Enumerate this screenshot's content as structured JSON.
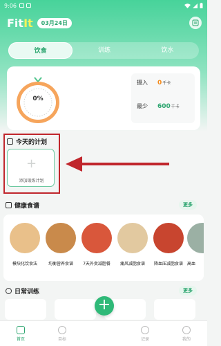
{
  "status_bar": {
    "time": "9:06"
  },
  "header": {
    "logo_main": "Fit",
    "logo_accent": "It",
    "date": "03月24日"
  },
  "tabs": [
    {
      "label": "饮食",
      "active": true
    },
    {
      "label": "训练",
      "active": false
    },
    {
      "label": "饮水",
      "active": false
    }
  ],
  "summary": {
    "percent": "0%",
    "intake_label": "摄入",
    "intake_value": "0",
    "intake_unit": "千卡",
    "min_label": "最少",
    "min_value": "600",
    "min_unit": "千卡"
  },
  "plan": {
    "title": "今天的计划",
    "add_label": "添加锻炼计划"
  },
  "recipes": {
    "title": "健康食谱",
    "more": "更多",
    "items": [
      {
        "name": "模块化饮食法",
        "color": "#e9c08a"
      },
      {
        "name": "均衡营养食谱",
        "color": "#c98a4b"
      },
      {
        "name": "7天外卖减脂餐",
        "color": "#d9573b"
      },
      {
        "name": "痛风减脂食谱",
        "color": "#e2c9a0"
      },
      {
        "name": "降血压减脂食谱",
        "color": "#c8452f"
      },
      {
        "name": "高血",
        "color": "#9bb0a4"
      }
    ]
  },
  "training": {
    "title": "日常训练",
    "more": "更多"
  },
  "bottom_nav": [
    {
      "label": "首页",
      "icon": "home-icon",
      "active": true
    },
    {
      "label": "目标",
      "icon": "target-icon",
      "active": false
    },
    {
      "label": "",
      "icon": "add-icon",
      "active": false
    },
    {
      "label": "记录",
      "icon": "clock-icon",
      "active": false
    },
    {
      "label": "我的",
      "icon": "user-icon",
      "active": false
    }
  ],
  "colors": {
    "brand": "#2fb978",
    "accent": "#f48a1a",
    "highlight": "#c0262c"
  }
}
